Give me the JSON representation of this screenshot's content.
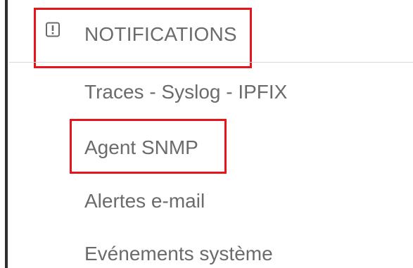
{
  "section": {
    "icon": "notification-alert-icon",
    "title": "NOTIFICATIONS"
  },
  "menu": {
    "items": [
      {
        "label": "Traces - Syslog - IPFIX"
      },
      {
        "label": "Agent SNMP"
      },
      {
        "label": "Alertes e-mail"
      },
      {
        "label": "Evénements système"
      }
    ]
  },
  "colors": {
    "highlight": "#e8141c",
    "text": "#6b6b6b",
    "rail": "#2f2f2f",
    "divider": "#d9d9d9"
  }
}
